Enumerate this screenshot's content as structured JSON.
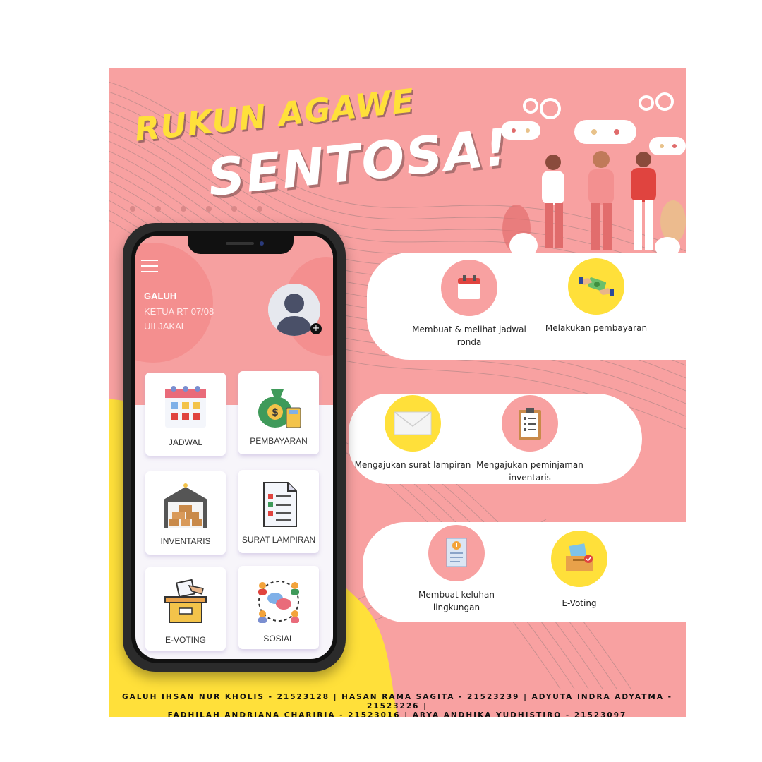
{
  "poster": {
    "title_line1": "RUKUN AGAWE",
    "title_line2": "SENTOSA!"
  },
  "app": {
    "user": {
      "name": "GALUH",
      "role": "KETUA RT 07/08",
      "org": "UII JAKAL"
    },
    "avatar_plus": "+",
    "menu": [
      {
        "label": "JADWAL",
        "icon": "calendar-icon"
      },
      {
        "label": "PEMBAYARAN",
        "icon": "money-bag-icon"
      },
      {
        "label": "INVENTARIS",
        "icon": "warehouse-boxes-icon"
      },
      {
        "label": "SURAT LAMPIRAN",
        "icon": "document-list-icon"
      },
      {
        "label": "E-VOTING",
        "icon": "ballot-box-icon"
      },
      {
        "label": "SOSIAL",
        "icon": "community-chat-icon"
      }
    ]
  },
  "features": [
    {
      "label": "Membuat & melihat jadwal ronda",
      "icon": "calendar-icon",
      "color": "#f8a1a1"
    },
    {
      "label": "Melakukan pembayaran",
      "icon": "payment-hands-icon",
      "color": "#ffe03a"
    },
    {
      "label": "Mengajukan surat lampiran",
      "icon": "envelope-icon",
      "color": "#ffe03a"
    },
    {
      "label": "Mengajukan peminjaman inventaris",
      "icon": "clipboard-icon",
      "color": "#f8a1a1"
    },
    {
      "label": "Membuat keluhan lingkungan",
      "icon": "complaint-document-icon",
      "color": "#f8a1a1"
    },
    {
      "label": "E-Voting",
      "icon": "ballot-box-icon",
      "color": "#ffe03a"
    }
  ],
  "credits": {
    "line1": "GALUH IHSAN NUR KHOLIS - 21523128 | HASAN RAMA SAGITA - 21523239 | ADYUTA INDRA ADYATMA - 21523226 |",
    "line2": "FADHILAH ANDRIANA CHARIRIA - 21523016 | ARYA ANDHIKA YUDHISTIRO - 21523097"
  },
  "colors": {
    "pink": "#f8a1a1",
    "yellow": "#ffe03a",
    "white": "#ffffff"
  }
}
